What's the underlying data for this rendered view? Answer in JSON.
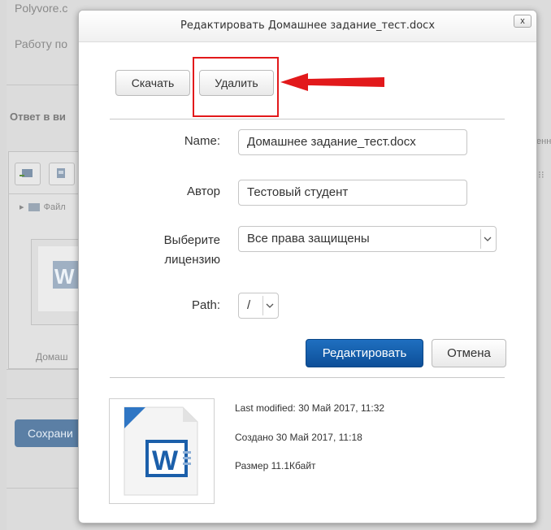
{
  "background": {
    "top_link": "Polyvore.c",
    "line2": "Работу по",
    "answer_heading": "Ответ в ви",
    "folder_label": "Файл",
    "file_label": "Домаш",
    "right_cut_text": "енн",
    "save_button": "Сохрани"
  },
  "dialog": {
    "title": "Редактировать Домашнее задание_тест.docx",
    "close_label": "x",
    "download_button": "Скачать",
    "delete_button": "Удалить",
    "form": {
      "name_label": "Name:",
      "name_value": "Домашнее задание_тест.docx",
      "author_label": "Автор",
      "author_value": "Тестовый студент",
      "license_label_line1": "Выберите",
      "license_label_line2": "лицензию",
      "license_value": "Все права защищены",
      "path_label": "Path:",
      "path_value": "/"
    },
    "edit_button": "Редактировать",
    "cancel_button": "Отмена",
    "info": {
      "last_modified_label": "Last modified:",
      "last_modified_value": "30 Май 2017, 11:32",
      "created_label": "Создано",
      "created_value": "30 Май 2017, 11:18",
      "size_label": "Размер",
      "size_value": "11.1Кбайт"
    }
  },
  "colors": {
    "highlight": "#e2191b",
    "primary_button": "#0d4f98",
    "word_blue": "#1b5faa"
  }
}
